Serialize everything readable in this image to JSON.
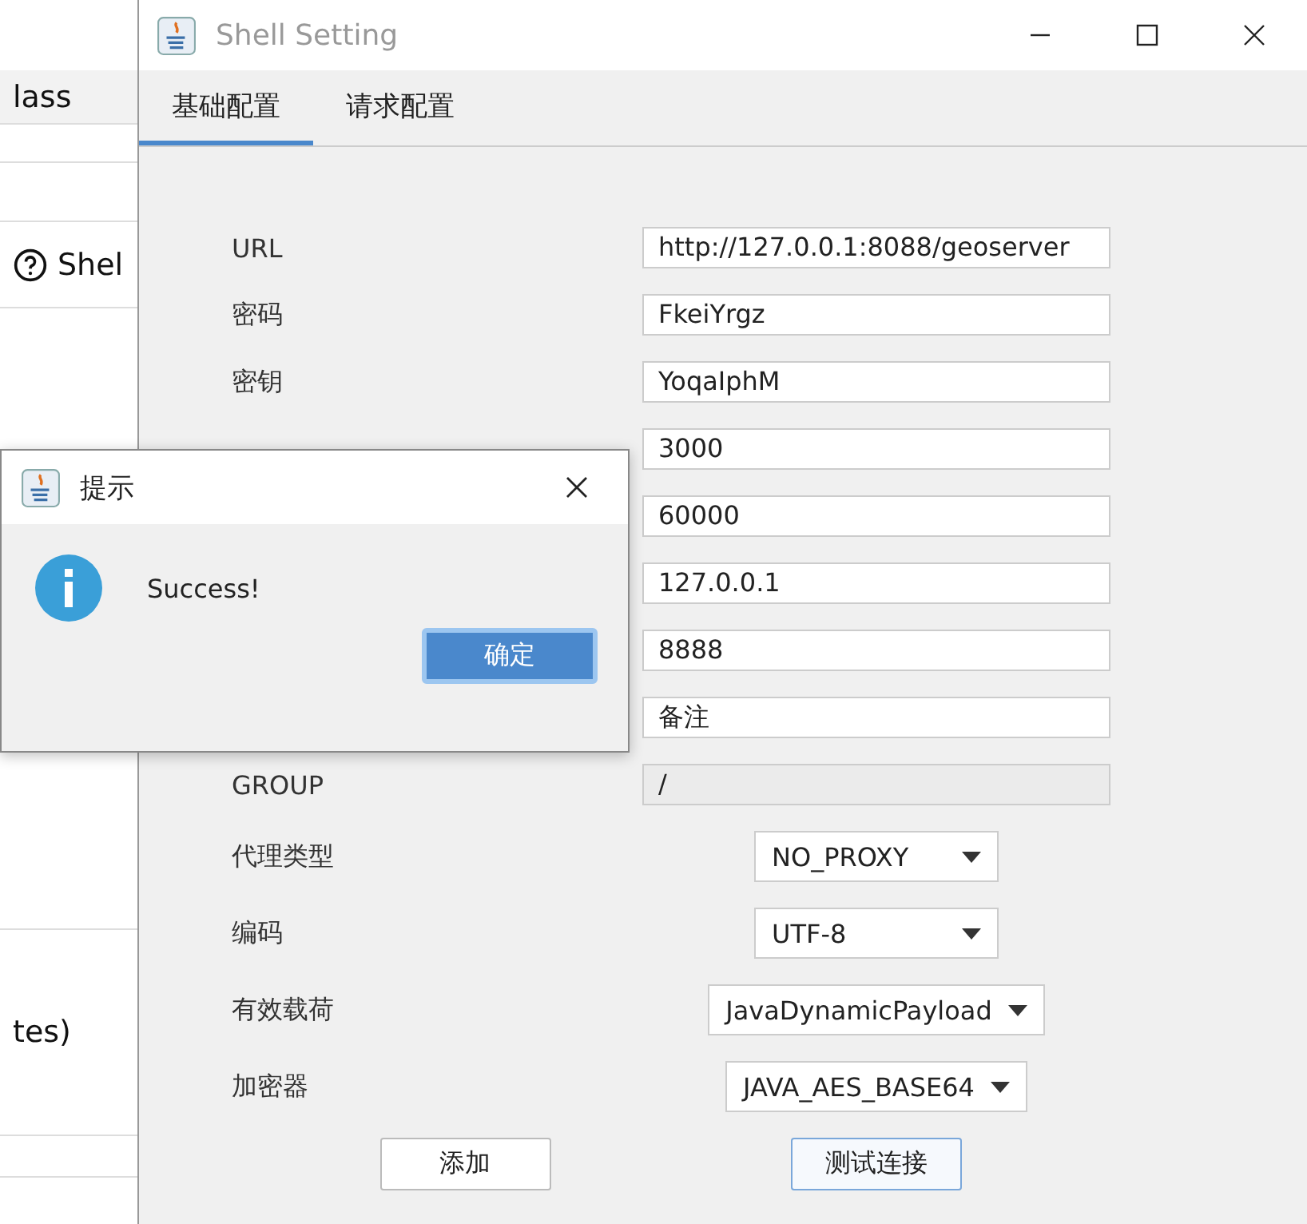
{
  "background_list": [
    {
      "kind": "plain",
      "text": "lass",
      "selected": true
    },
    {
      "kind": "help",
      "text": "Shel",
      "selected": false
    },
    {
      "kind": "plain",
      "text": "tes)",
      "selected": false
    }
  ],
  "window": {
    "title": "Shell Setting"
  },
  "tabs": [
    {
      "label": "基础配置",
      "selected": true
    },
    {
      "label": "请求配置",
      "selected": false
    }
  ],
  "fields": [
    {
      "label": "URL",
      "value": "http://127.0.0.1:8088/geoserver",
      "disabled": false
    },
    {
      "label": "密码",
      "value": "FkeiYrgz",
      "disabled": false
    },
    {
      "label": "密钥",
      "value": "YoqaIphM",
      "disabled": false
    },
    {
      "value": "3000",
      "disabled": false
    },
    {
      "value": "60000",
      "disabled": false
    },
    {
      "value": "127.0.0.1",
      "disabled": false
    },
    {
      "value": "8888",
      "disabled": false
    },
    {
      "value": "备注",
      "disabled": false
    },
    {
      "label": "GROUP",
      "value": "/",
      "disabled": true
    }
  ],
  "dropdowns": [
    {
      "label": "代理类型",
      "value": "NO_PROXY"
    },
    {
      "label": "编码",
      "value": "UTF-8"
    },
    {
      "label": "有效载荷",
      "value": "JavaDynamicPayload"
    },
    {
      "label": "加密器",
      "value": "JAVA_AES_BASE64"
    }
  ],
  "buttons": [
    {
      "label": "添加",
      "focused": false
    },
    {
      "label": "测试连接",
      "focused": true
    }
  ],
  "dialog": {
    "title": "提示",
    "message": "Success!",
    "button": "确定"
  }
}
